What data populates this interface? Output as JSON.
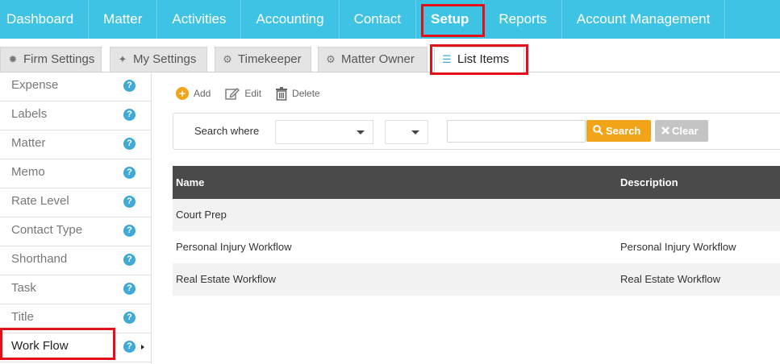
{
  "topnav": {
    "items": [
      {
        "label": "Dashboard"
      },
      {
        "label": "Matter"
      },
      {
        "label": "Activities"
      },
      {
        "label": "Accounting"
      },
      {
        "label": "Contact"
      },
      {
        "label": "Setup"
      },
      {
        "label": "Reports"
      },
      {
        "label": "Account Management"
      }
    ],
    "active": "Setup"
  },
  "tabs": [
    {
      "label": "Firm Settings",
      "icon": "gear-icon"
    },
    {
      "label": "My Settings",
      "icon": "wrench-icon"
    },
    {
      "label": "Timekeeper",
      "icon": "gears-icon"
    },
    {
      "label": "Matter Owner",
      "icon": "gear-icon"
    },
    {
      "label": "List Items",
      "icon": "list-icon"
    }
  ],
  "active_tab": "List Items",
  "sidebar": {
    "items": [
      {
        "label": "Expense"
      },
      {
        "label": "Labels"
      },
      {
        "label": "Matter"
      },
      {
        "label": "Memo"
      },
      {
        "label": "Rate Level"
      },
      {
        "label": "Contact Type"
      },
      {
        "label": "Shorthand"
      },
      {
        "label": "Task"
      },
      {
        "label": "Title"
      },
      {
        "label": "Work Flow"
      }
    ],
    "active": "Work Flow"
  },
  "toolbar": {
    "add_label": "Add",
    "edit_label": "Edit",
    "delete_label": "Delete"
  },
  "search": {
    "label": "Search where",
    "field_value": "",
    "operator_value": "",
    "query_value": "",
    "search_button": "Search",
    "clear_button": "Clear"
  },
  "table": {
    "columns": [
      "Name",
      "Description"
    ],
    "rows": [
      {
        "name": "Court Prep",
        "description": ""
      },
      {
        "name": "Personal Injury Workflow",
        "description": "Personal Injury Workflow"
      },
      {
        "name": "Real Estate Workflow",
        "description": "Real Estate Workflow"
      }
    ]
  },
  "colors": {
    "nav_bg": "#3fc3e4",
    "highlight": "#e3101a",
    "accent_orange": "#f2a419",
    "help_blue": "#3fa9d9",
    "table_header": "#4a4a4a"
  }
}
